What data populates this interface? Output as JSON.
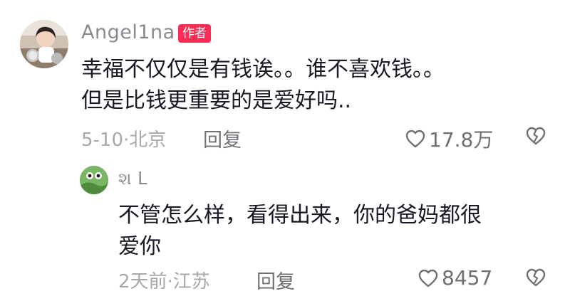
{
  "comments": [
    {
      "username": "Angel1na",
      "badge": "作者",
      "text": "幸福不仅仅是有钱诶。。谁不喜欢钱。。\n但是比钱更重要的是爱好吗..",
      "meta": "5-10·北京",
      "reply_label": "回复",
      "likes": "17.8万"
    },
    {
      "username": "શ ᒪ",
      "text": "不管怎么样，看得出来，你的爸妈都很\n爱你",
      "meta": "2天前·江苏",
      "reply_label": "回复",
      "likes": "8457"
    }
  ],
  "colors": {
    "badge": "#fe2c55",
    "text": "#161823",
    "secondary": "#a7a8ad"
  }
}
